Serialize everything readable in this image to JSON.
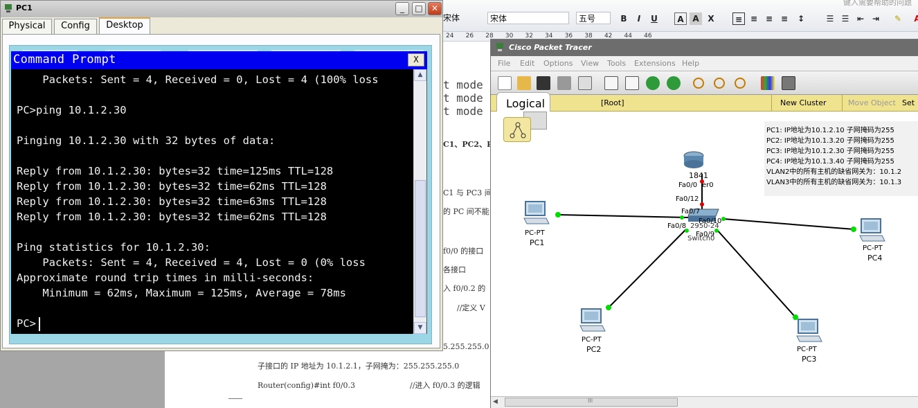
{
  "word": {
    "font_name": "宋体",
    "font_family_combo": "宋体",
    "font_size": "五号",
    "top_right_hint": "键入需要帮助的问题",
    "ruler_numbers": [
      "24",
      "26",
      "28",
      "30",
      "32",
      "34",
      "36",
      "38",
      "42",
      "44",
      "46"
    ],
    "side_lines": [
      "t mode",
      "t mode",
      "t mode",
      "C1、PC2、P",
      "C1 与 PC3 间",
      "的 PC 间不能",
      "f0/0 的接口",
      "各接口",
      "入 f0/0.2 的",
      "//定义 V",
      "5.255.255.0"
    ],
    "bottom_line1": "子接口的 IP 地址为 10.1.2.1，子网掩为：255.255.255.0",
    "bottom_line2_a": "Router(config)#int  f0/0.3",
    "bottom_line2_b": "//进入 f0/0.3 的逻辑"
  },
  "pc1": {
    "title": "PC1",
    "tabs": [
      "Physical",
      "Config",
      "Desktop"
    ],
    "active_tab": "Desktop",
    "cmd_title": "Command Prompt",
    "cmd_close": "X",
    "terminal_lines": [
      "    Packets: Sent = 4, Received = 0, Lost = 4 (100% loss",
      "",
      "PC>ping 10.1.2.30",
      "",
      "Pinging 10.1.2.30 with 32 bytes of data:",
      "",
      "Reply from 10.1.2.30: bytes=32 time=125ms TTL=128",
      "Reply from 10.1.2.30: bytes=32 time=62ms TTL=128",
      "Reply from 10.1.2.30: bytes=32 time=63ms TTL=128",
      "Reply from 10.1.2.30: bytes=32 time=62ms TTL=128",
      "",
      "Ping statistics for 10.1.2.30:",
      "    Packets: Sent = 4, Received = 4, Lost = 0 (0% loss",
      "Approximate round trip times in milli-seconds:",
      "    Minimum = 62ms, Maximum = 125ms, Average = 78ms",
      "",
      "PC>"
    ]
  },
  "pt": {
    "title": "Cisco Packet Tracer",
    "menu": [
      "File",
      "Edit",
      "Options",
      "View",
      "Tools",
      "Extensions",
      "Help"
    ],
    "logical_label": "Logical",
    "root_label": "[Root]",
    "new_cluster": "New Cluster",
    "move_object": "Move Object",
    "set_label": "Set",
    "router_name": "1841",
    "switch_name": "2950-24",
    "switch_label": "Switch0",
    "ports": {
      "router_fa00": "Fa0/0",
      "router_fa00_tail": "er0",
      "sw_fa012": "Fa0/12",
      "sw_fa07": "Fa0/7",
      "sw_fa08": "Fa0/8",
      "sw_fa09": "Fa0/9",
      "sw_fa010": "Fa0/10"
    },
    "devices": [
      {
        "type": "PC-PT",
        "name": "PC1"
      },
      {
        "type": "PC-PT",
        "name": "PC2"
      },
      {
        "type": "PC-PT",
        "name": "PC3"
      },
      {
        "type": "PC-PT",
        "name": "PC4"
      }
    ],
    "notes": [
      "PC1:  IP地址为10.1.2.10 子网掩码为255",
      "PC2:  IP地址为10.1.3.20 子网掩码为255",
      "PC3:  IP地址为10.1.2.30 子网掩码为255",
      "PC4:  IP地址为10.1.3.40 子网掩码为255",
      "VLAN2中的所有主机的缺省网关为：10.1.2",
      "VLAN3中的所有主机的缺省网关为：10.1.3"
    ],
    "hscroll_grip": "III"
  },
  "colors": {
    "cmd_title_bg": "#0000f0",
    "link_green": "#00dd00",
    "link_red": "#dd0000",
    "pt_bar": "#f0e38f"
  }
}
